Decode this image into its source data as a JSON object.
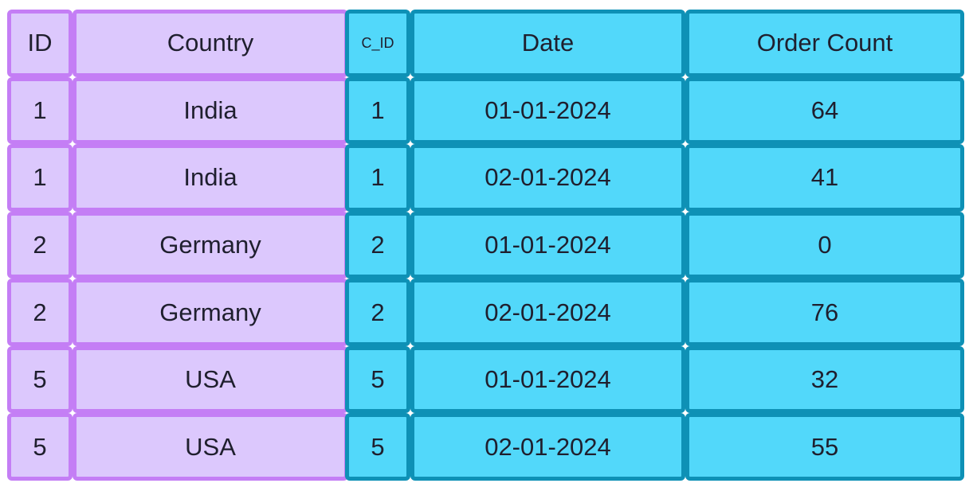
{
  "left_table": {
    "columns": [
      "ID",
      "Country"
    ],
    "rows": [
      [
        "1",
        "India"
      ],
      [
        "1",
        "India"
      ],
      [
        "2",
        "Germany"
      ],
      [
        "2",
        "Germany"
      ],
      [
        "5",
        "USA"
      ],
      [
        "5",
        "USA"
      ]
    ]
  },
  "right_table": {
    "columns": [
      "C_ID",
      "Date",
      "Order Count"
    ],
    "rows": [
      [
        "1",
        "01-01-2024",
        "64"
      ],
      [
        "1",
        "02-01-2024",
        "41"
      ],
      [
        "2",
        "01-01-2024",
        "0"
      ],
      [
        "2",
        "02-01-2024",
        "76"
      ],
      [
        "5",
        "01-01-2024",
        "32"
      ],
      [
        "5",
        "02-01-2024",
        "55"
      ]
    ]
  },
  "colors": {
    "left_fill": "#dcc8fd",
    "left_border": "#c47ef5",
    "right_fill": "#52d8fa",
    "right_border": "#0e91b6"
  }
}
